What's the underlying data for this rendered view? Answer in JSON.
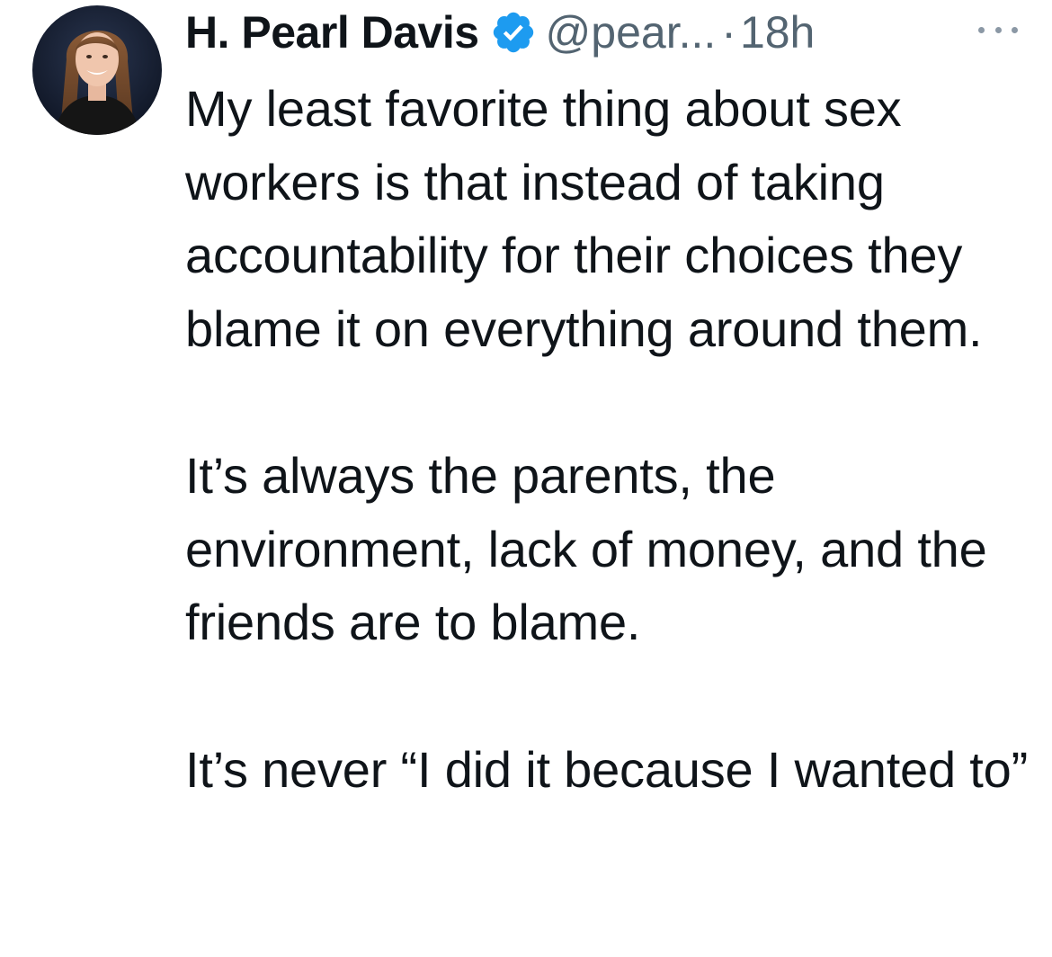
{
  "author": {
    "display_name": "H. Pearl Davis",
    "handle": "@pear...",
    "separator": "·",
    "timestamp": "18h",
    "avatar_icon": "profile-photo",
    "verified_icon": "verified-badge-icon",
    "verified_color": "#1d9bf0"
  },
  "menu": {
    "more_icon": "more-options-icon"
  },
  "tweet": {
    "paragraphs": [
      "My least favorite thing about sex workers is that instead of taking accountability for their choices they blame it on everything around them.",
      "It’s always the parents, the environment, lack of money, and the friends are to blame.",
      "It’s never “I did it because I wanted to”"
    ]
  },
  "colors": {
    "text": "#0f1419",
    "secondary": "#536471",
    "background": "#ffffff"
  }
}
